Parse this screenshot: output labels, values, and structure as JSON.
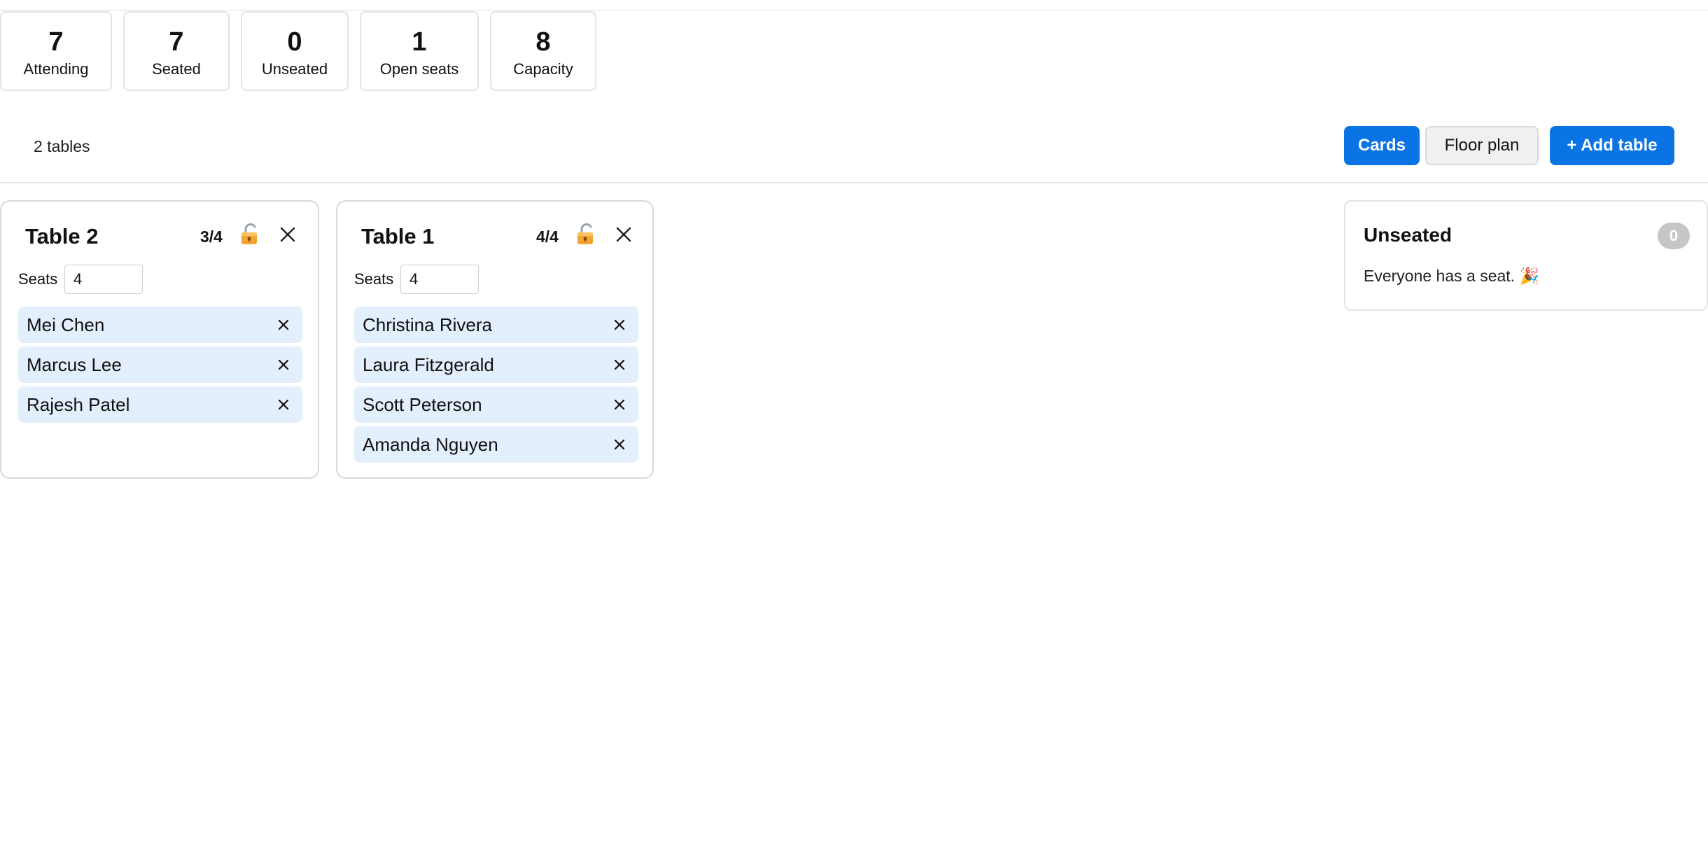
{
  "stats": [
    {
      "value": "7",
      "label": "Attending"
    },
    {
      "value": "7",
      "label": "Seated"
    },
    {
      "value": "0",
      "label": "Unseated"
    },
    {
      "value": "1",
      "label": "Open seats"
    },
    {
      "value": "8",
      "label": "Capacity"
    }
  ],
  "toolbar": {
    "table_count": "2 tables",
    "cards_label": "Cards",
    "floor_plan_label": "Floor plan",
    "add_table_label": "+ Add table"
  },
  "tables": [
    {
      "title": "Table 2",
      "count": "3/4",
      "seats_label": "Seats",
      "seats_value": "4",
      "guests": [
        "Mei Chen",
        "Marcus Lee",
        "Rajesh Patel"
      ]
    },
    {
      "title": "Table 1",
      "count": "4/4",
      "seats_label": "Seats",
      "seats_value": "4",
      "guests": [
        "Christina Rivera",
        "Laura Fitzgerald",
        "Scott Peterson",
        "Amanda Nguyen"
      ]
    }
  ],
  "unseated": {
    "title": "Unseated",
    "count": "0",
    "message": "Everyone has a seat. 🎉"
  },
  "colors": {
    "accent": "#0b74e4",
    "guest_chip": "#e3effc",
    "badge": "#c6c6c6"
  }
}
